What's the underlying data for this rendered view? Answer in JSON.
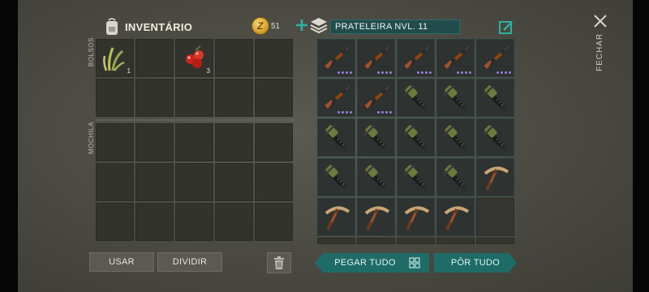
{
  "inventory": {
    "title": "INVENTÁRIO",
    "coins": "51",
    "pockets_label": "BOLSOS",
    "backpack_label": "MOCHILA",
    "pockets": [
      {
        "item": "grass-icon",
        "qty": "1"
      },
      {
        "item": "",
        "qty": ""
      },
      {
        "item": "berries-icon",
        "qty": "3"
      },
      {
        "item": "",
        "qty": ""
      },
      {
        "item": "",
        "qty": ""
      },
      {
        "item": "",
        "qty": ""
      },
      {
        "item": "",
        "qty": ""
      },
      {
        "item": "",
        "qty": ""
      },
      {
        "item": "",
        "qty": ""
      },
      {
        "item": "",
        "qty": ""
      }
    ],
    "backpack_rows": 3,
    "use_label": "USAR",
    "split_label": "DIVIDIR"
  },
  "shelf": {
    "title": "PRATELEIRA NVL. 11",
    "slots": [
      "rifle",
      "rifle",
      "rifle",
      "rifle",
      "rifle",
      "rifle",
      "rifle",
      "crossbow",
      "crossbow",
      "crossbow",
      "crossbow",
      "crossbow",
      "crossbow",
      "crossbow",
      "crossbow",
      "crossbow",
      "crossbow",
      "crossbow",
      "crossbow",
      "pickaxe",
      "pickaxe",
      "pickaxe",
      "pickaxe",
      "pickaxe",
      "",
      "",
      "",
      "",
      "",
      ""
    ],
    "take_all_label": "PEGAR TUDO",
    "put_all_label": "PÔR TUDO"
  },
  "close_label": "FECHAR",
  "colors": {
    "teal": "#1f6b67",
    "rifle_dots": "#9a7fe0"
  }
}
